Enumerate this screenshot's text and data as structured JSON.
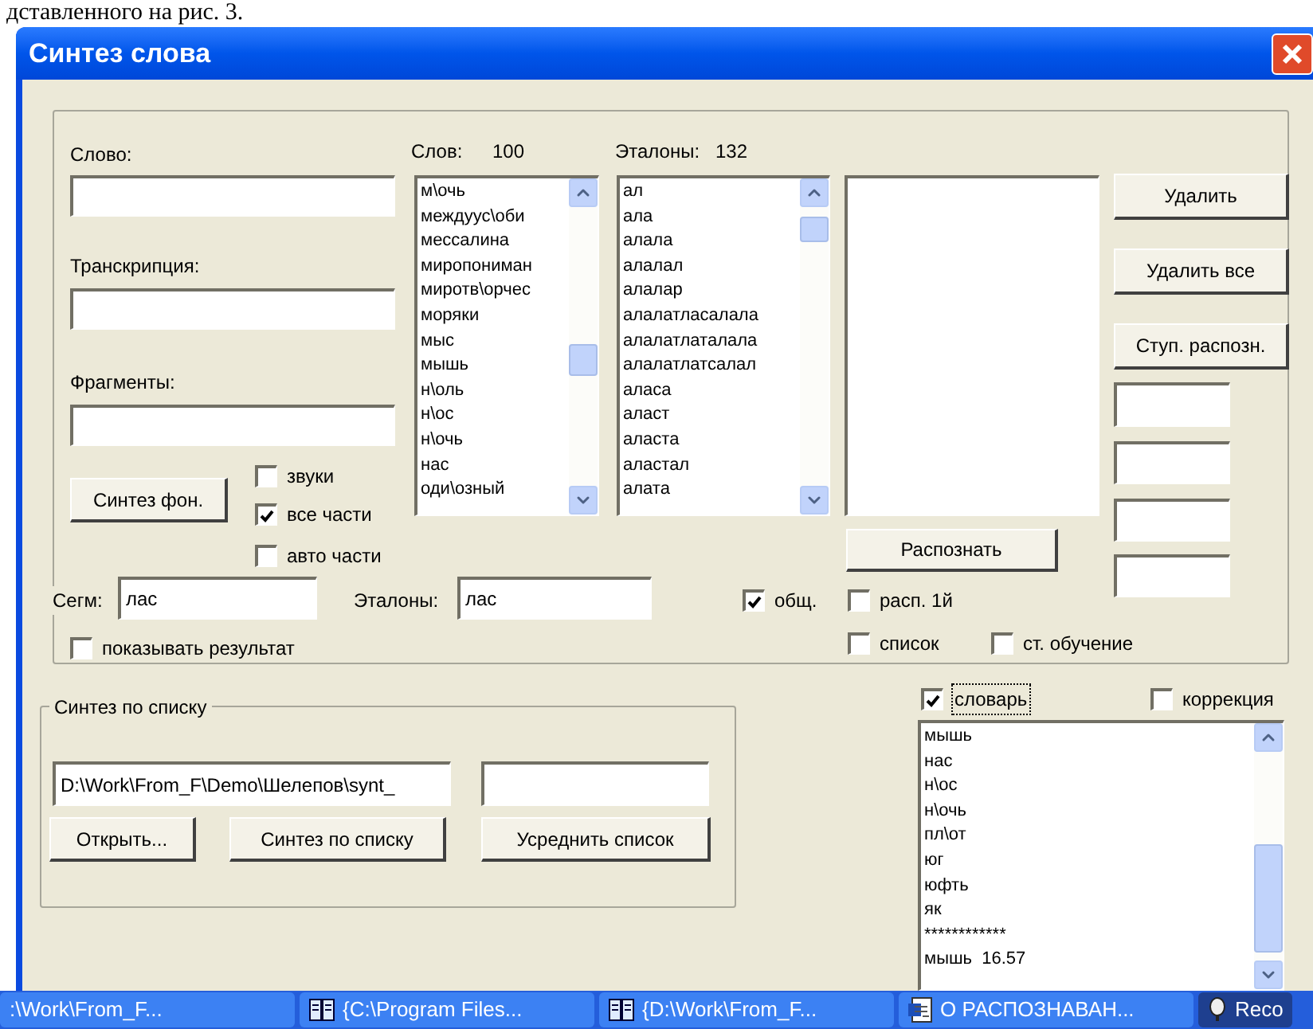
{
  "document_text": "дставленного на рис. 3.",
  "window": {
    "title": "Синтез слова"
  },
  "word": {
    "label": "Слово:"
  },
  "transcription": {
    "label": "Транскрипция:"
  },
  "fragments": {
    "label": "Фрагменты:"
  },
  "synth_phon_button": "Синтез фон.",
  "options": [
    {
      "label": "звуки",
      "checked": false
    },
    {
      "label": "все части",
      "checked": true
    },
    {
      "label": "авто части",
      "checked": false
    }
  ],
  "words_count": {
    "label": "Слов:",
    "value": "100"
  },
  "etalons_count": {
    "label": "Эталоны:",
    "value": "132"
  },
  "words_list": [
    "м\\очь",
    "междуус\\оби",
    "мессалина",
    "миропониман",
    "миротв\\орчес",
    "моряки",
    "мыс",
    "мышь",
    "н\\оль",
    "н\\ос",
    "н\\очь",
    "нас",
    "оди\\озный"
  ],
  "etalons_list": [
    "ал",
    "ала",
    "алала",
    "алалал",
    "алалар",
    "алалатласалала",
    "алалатлаталала",
    "алалатлатсалал",
    "аласа",
    "аласт",
    "аласта",
    "аластал",
    "алата"
  ],
  "buttons": [
    "Удалить",
    "Удалить все",
    "Ступ. распозн."
  ],
  "recognize_button": "Распознать",
  "segm": {
    "label": "Сегм:",
    "value": "лас"
  },
  "etalons_field": {
    "label": "Эталоны:",
    "value": "лас"
  },
  "common": {
    "label": "общ.",
    "checked": true
  },
  "recognize_first": {
    "label": "расп. 1й",
    "checked": false
  },
  "list_option": {
    "label": "список",
    "checked": false
  },
  "step_training": {
    "label": "ст. обучение",
    "checked": false
  },
  "show_result": {
    "label": "показывать результат",
    "checked": false
  },
  "list_synthesis": {
    "title": "Синтез по списку",
    "path": "D:\\Work\\From_F\\Demo\\Шелепов\\synt_",
    "buttons": [
      "Открыть...",
      "Синтез по списку",
      "Усреднить список"
    ]
  },
  "dictionary": {
    "label": "словарь",
    "checked": true
  },
  "correction": {
    "label": "коррекция",
    "checked": false
  },
  "result_list": [
    "мышь",
    "нас",
    "н\\ос",
    "н\\очь",
    "пл\\от",
    "юг",
    "юфть",
    "як",
    "************",
    "мышь  16.57"
  ],
  "taskbar": [
    {
      "label": ":\\Work\\From_F...",
      "kind": "none",
      "selected": false
    },
    {
      "label": "{C:\\Program Files...",
      "kind": "book",
      "selected": false
    },
    {
      "label": "{D:\\Work\\From_F...",
      "kind": "book",
      "selected": false
    },
    {
      "label": "О РАСПОЗНАВАН...",
      "kind": "document",
      "selected": false
    },
    {
      "label": "Reco",
      "kind": "player",
      "selected": true
    }
  ]
}
